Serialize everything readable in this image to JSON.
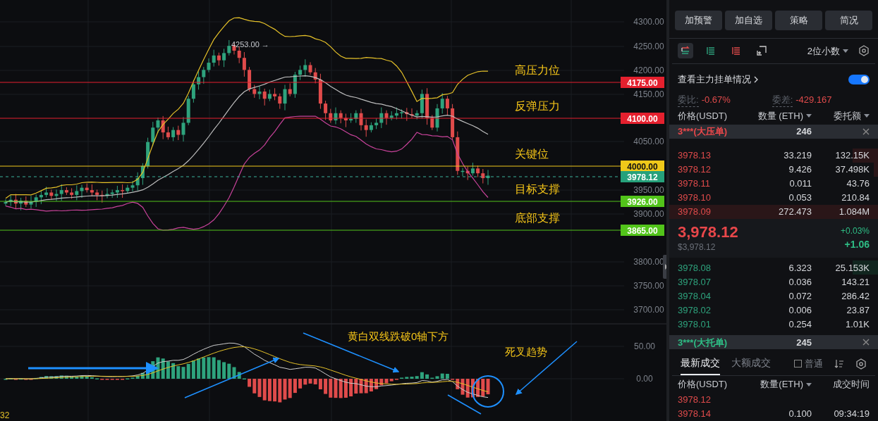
{
  "chart": {
    "price_axis": [
      "4300.00",
      "4250.00",
      "4200.00",
      "4150.00",
      "4050.00",
      "3950.00",
      "3900.00",
      "3800.00",
      "3750.00",
      "3700.00"
    ],
    "peak_label": "4253.00 →",
    "levels": [
      {
        "tag": "4175.00",
        "color": "#e5202e",
        "dark_text": false,
        "annotation": "高压力位"
      },
      {
        "tag": "4100.00",
        "color": "#e5202e",
        "dark_text": false,
        "annotation": "反弹压力"
      },
      {
        "tag": "4000.00",
        "color": "#f0c91a",
        "dark_text": true,
        "annotation": "关键位"
      },
      {
        "tag": "3926.00",
        "color": "#52c41a",
        "dark_text": false,
        "annotation": "目标支撑"
      },
      {
        "tag": "3865.00",
        "color": "#52c41a",
        "dark_text": false,
        "annotation": "底部支撑"
      }
    ],
    "current_price_tag": "3978.12",
    "macd_axis": [
      "50.00",
      "0.00"
    ],
    "macd_annotations": [
      "黄白双线跌破0轴下方",
      "死叉趋势"
    ],
    "macd_reading": "32"
  },
  "panel": {
    "buttons": [
      "加预警",
      "加自选",
      "策略",
      "简况"
    ],
    "view_tabs": [
      {
        "kind": "both",
        "selected": true
      },
      {
        "kind": "bids",
        "selected": false
      },
      {
        "kind": "asks",
        "selected": false
      },
      {
        "kind": "depth",
        "selected": false
      }
    ],
    "precision": "2位小数",
    "main_orders": {
      "label": "查看主力挂单情况",
      "on": true
    },
    "ratio": {
      "label": "委比:",
      "value": "-0.67%"
    },
    "diff": {
      "label": "委差:",
      "value": "-429.167"
    },
    "book_columns": [
      {
        "label": "价格(USDT)",
        "sortable": false
      },
      {
        "label": "数量 (ETH)",
        "sortable": true
      },
      {
        "label": "委托额",
        "sortable": true
      }
    ],
    "ask_wall": {
      "label": "3***(大压单)",
      "amount": "246"
    },
    "asks": [
      {
        "price": "3978.13",
        "qty": "33.219",
        "total": "132.15K",
        "level": 0.12
      },
      {
        "price": "3978.12",
        "qty": "9.426",
        "total": "37.498K",
        "level": 0.02
      },
      {
        "price": "3978.11",
        "qty": "0.011",
        "total": "43.76"
      },
      {
        "price": "3978.10",
        "qty": "0.053",
        "total": "210.84"
      },
      {
        "price": "3978.09",
        "qty": "272.473",
        "total": "1.084M",
        "level": 1
      }
    ],
    "last": {
      "price": "3,978.12",
      "usd": "$3,978.12",
      "change_pct": "+0.03%",
      "change": "+1.06"
    },
    "bids": [
      {
        "price": "3978.08",
        "qty": "6.323",
        "total": "25.153K",
        "level": 0.12
      },
      {
        "price": "3978.07",
        "qty": "0.036",
        "total": "143.21"
      },
      {
        "price": "3978.04",
        "qty": "0.072",
        "total": "286.42"
      },
      {
        "price": "3978.02",
        "qty": "0.006",
        "total": "23.87"
      },
      {
        "price": "3978.01",
        "qty": "0.254",
        "total": "1.01K"
      }
    ],
    "bid_wall": {
      "label": "3***(大托单)",
      "amount": "245"
    },
    "trade_tabs": [
      {
        "label": "最新成交",
        "selected": true
      },
      {
        "label": "大额成交",
        "selected": false
      }
    ],
    "normal_filter": {
      "label": "普通",
      "checked": false
    },
    "trade_columns": [
      {
        "label": "价格(USDT)",
        "sortable": false
      },
      {
        "label": "数量(ETH)",
        "sortable": true
      },
      {
        "label": "成交时间",
        "sortable": false
      }
    ],
    "trades": [
      {
        "price": "3978.12"
      },
      {
        "price": "3978.14",
        "qty": "0.100",
        "time": "09:34:19"
      }
    ]
  }
}
